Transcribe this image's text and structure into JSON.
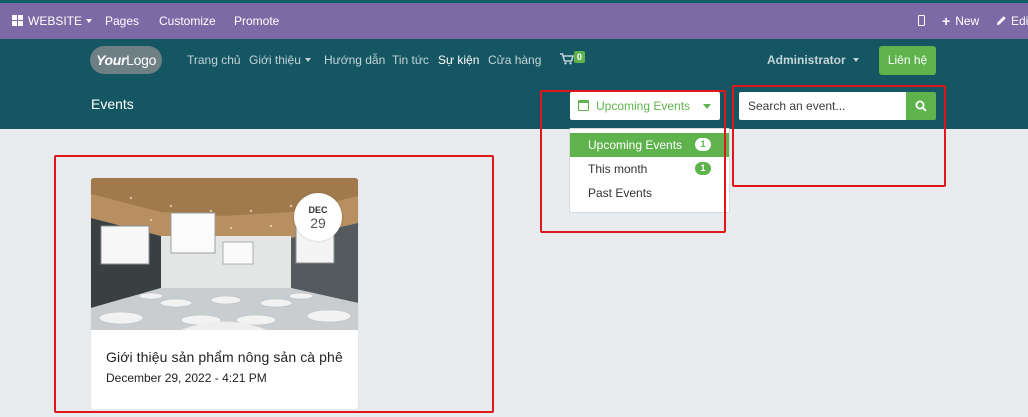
{
  "admin_bar": {
    "website_label": "WEBSITE",
    "pages_label": "Pages",
    "customize_label": "Customize",
    "promote_label": "Promote",
    "new_label": "New",
    "edit_label": "Edit"
  },
  "navbar": {
    "logo_bold": "Your",
    "logo_rest": "Logo",
    "links": [
      "Trang chủ",
      "Giới thiệu",
      "Hướng dẫn",
      "Tin tức",
      "Sự kiện",
      "Cửa hàng"
    ],
    "active_link": "Sự kiện",
    "cart_count": "0",
    "user_label": "Administrator",
    "contact_button": "Liên hệ"
  },
  "events_header": {
    "title": "Events",
    "filter_selected": "Upcoming Events",
    "search_placeholder": "Search an event..."
  },
  "filter_dropdown": {
    "items": [
      {
        "label": "Upcoming Events",
        "count": "1",
        "active": true
      },
      {
        "label": "This month",
        "count": "1",
        "active": false
      },
      {
        "label": "Past Events",
        "count": "",
        "active": false
      }
    ]
  },
  "events": [
    {
      "month": "DEC",
      "day": "29",
      "title": "Giới thiệu sản phẩm nông sản cà phê",
      "datetime": "December 29, 2022 - 4:21 PM"
    }
  ],
  "colors": {
    "admin_bar": "#7c6aa6",
    "navbar": "#155663",
    "accent_green": "#5fb34c",
    "page_bg": "#e9ecef",
    "annotation_red": "#e0161c"
  }
}
